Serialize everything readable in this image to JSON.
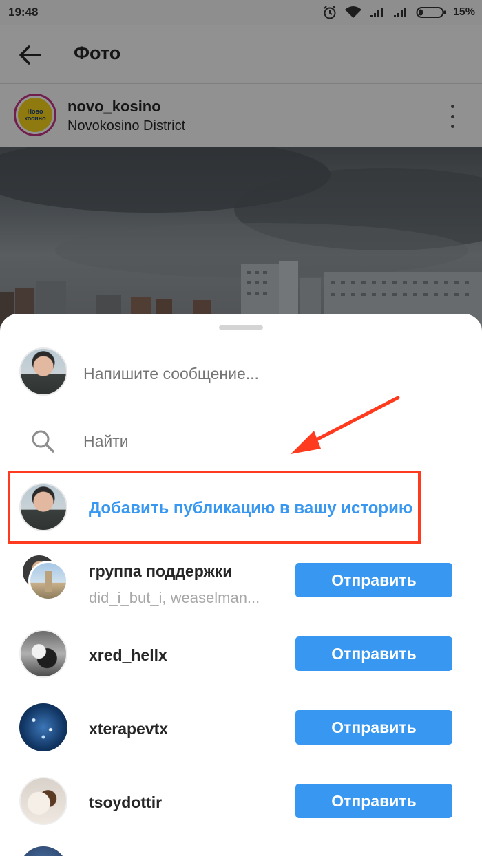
{
  "status_bar": {
    "time": "19:48",
    "battery_percent": "15%",
    "icons": [
      "alarm-icon",
      "wifi-icon",
      "signal-icon",
      "signal-icon",
      "battery-icon"
    ]
  },
  "app_bar": {
    "title": "Фото",
    "back_icon": "arrow-left-icon"
  },
  "post": {
    "username": "novo_kosino",
    "location": "Novokosino District",
    "avatar_text": [
      "Ново",
      "косино"
    ],
    "more_icon": "more-vertical-icon"
  },
  "share_sheet": {
    "message_placeholder": "Напишите сообщение...",
    "search_placeholder": "Найти",
    "add_to_story_label": "Добавить публикацию в вашу историю",
    "contacts": [
      {
        "name": "группа поддержки",
        "subtitle": "did_i_but_i, weaselman...",
        "button": "Отправить"
      },
      {
        "name": "xred_hellx",
        "button": "Отправить"
      },
      {
        "name": "xterapevtx",
        "button": "Отправить"
      },
      {
        "name": "tsoydottir",
        "button": "Отправить"
      }
    ]
  },
  "colors": {
    "accent": "#3897f0",
    "highlight": "#ff3b1f"
  }
}
